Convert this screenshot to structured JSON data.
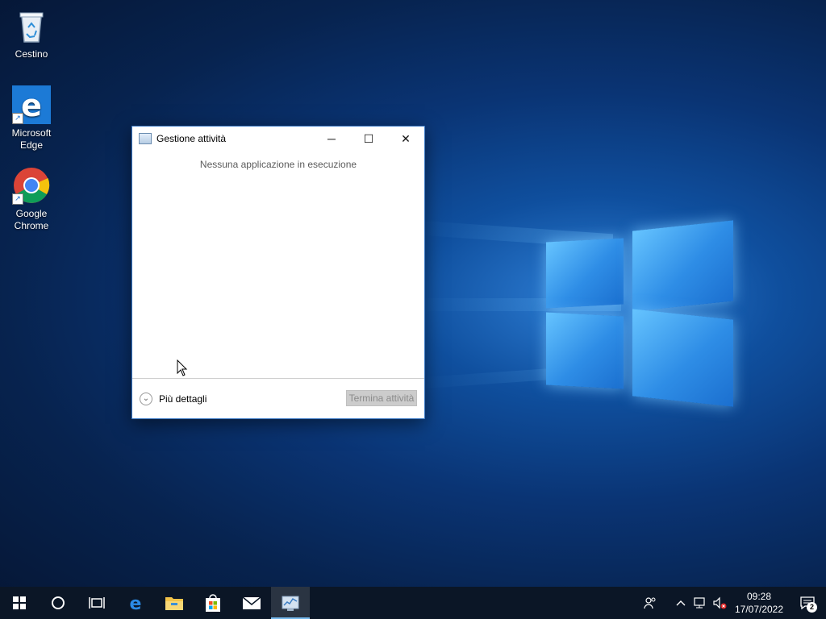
{
  "desktop": {
    "icons": [
      {
        "label": "Cestino",
        "icon": "recycle-bin-icon"
      },
      {
        "label": "Microsoft Edge",
        "icon": "edge-icon"
      },
      {
        "label": "Google Chrome",
        "icon": "chrome-icon"
      }
    ]
  },
  "task_manager": {
    "title": "Gestione attività",
    "empty_message": "Nessuna applicazione in esecuzione",
    "more_details_label": "Più dettagli",
    "end_task_label": "Termina attività",
    "buttons": {
      "minimize": "─",
      "maximize": "☐",
      "close": "✕"
    }
  },
  "taskbar": {
    "items": [
      "windows-start-icon",
      "cortana-icon",
      "task-view-icon",
      "edge-icon",
      "file-explorer-icon",
      "store-icon",
      "mail-icon",
      "task-manager-icon"
    ],
    "active_item": "task-manager-icon",
    "tray": {
      "time": "09:28",
      "date": "17/07/2022",
      "notification_count": "2"
    }
  },
  "colors": {
    "accent": "#76b9ed",
    "taskbar": "#0b1626",
    "window_border": "#3a78c4"
  }
}
